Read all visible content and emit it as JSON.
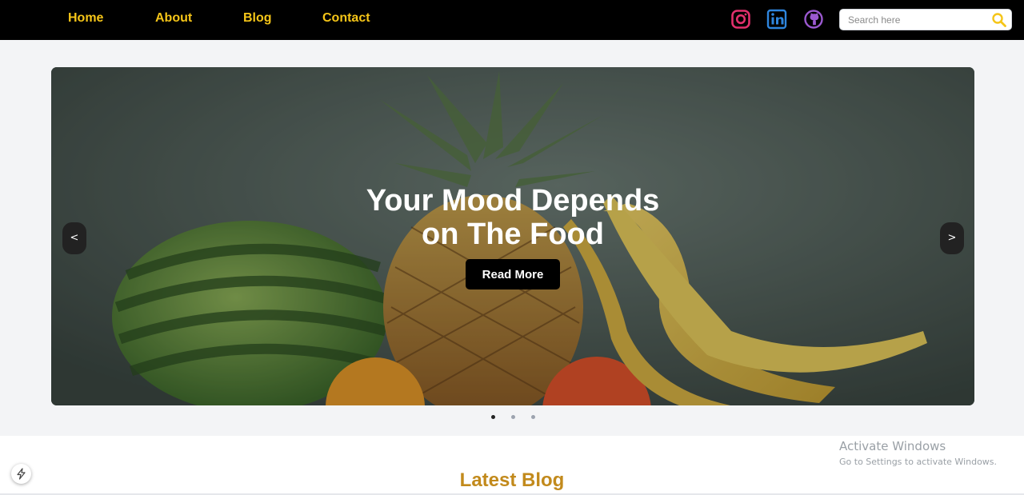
{
  "nav": {
    "links": [
      "Home",
      "About",
      "Blog",
      "Contact"
    ],
    "link_color": "#f5c518"
  },
  "social": {
    "icons": [
      "instagram-icon",
      "linkedin-icon",
      "github-icon"
    ],
    "colors": {
      "instagram": "#e1306c",
      "linkedin": "#2e86de",
      "github": "#9b59d0"
    }
  },
  "search": {
    "placeholder": "Search here",
    "value": "",
    "icon": "search-icon"
  },
  "hero": {
    "title_line1": "Your Mood Depends",
    "title_line2": "on The Food",
    "button": "Read More",
    "prev": "<",
    "next": ">",
    "slides_count": 3,
    "active_slide": 1
  },
  "latest": {
    "title": "Latest Blog",
    "title_color": "#c28a1c"
  },
  "watermark": {
    "title": "Activate Windows",
    "subtitle": "Go to Settings to activate Windows."
  }
}
